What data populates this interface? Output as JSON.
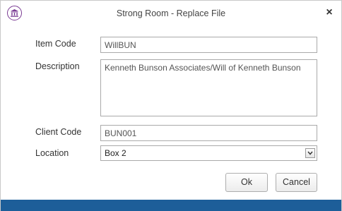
{
  "window": {
    "title": "Strong Room - Replace File",
    "close_glyph": "×",
    "app_icon": "institution-icon",
    "accent_color": "#7a3b93",
    "footer_color": "#1d5e99"
  },
  "form": {
    "item_code": {
      "label": "Item Code",
      "value": "WillBUN"
    },
    "description": {
      "label": "Description",
      "value": "Kenneth Bunson Associates/Will of Kenneth Bunson"
    },
    "client_code": {
      "label": "Client Code",
      "value": "BUN001"
    },
    "location": {
      "label": "Location",
      "value": "Box 2",
      "arrow_icon": "chevron-down-icon"
    }
  },
  "buttons": {
    "ok": "Ok",
    "cancel": "Cancel"
  }
}
